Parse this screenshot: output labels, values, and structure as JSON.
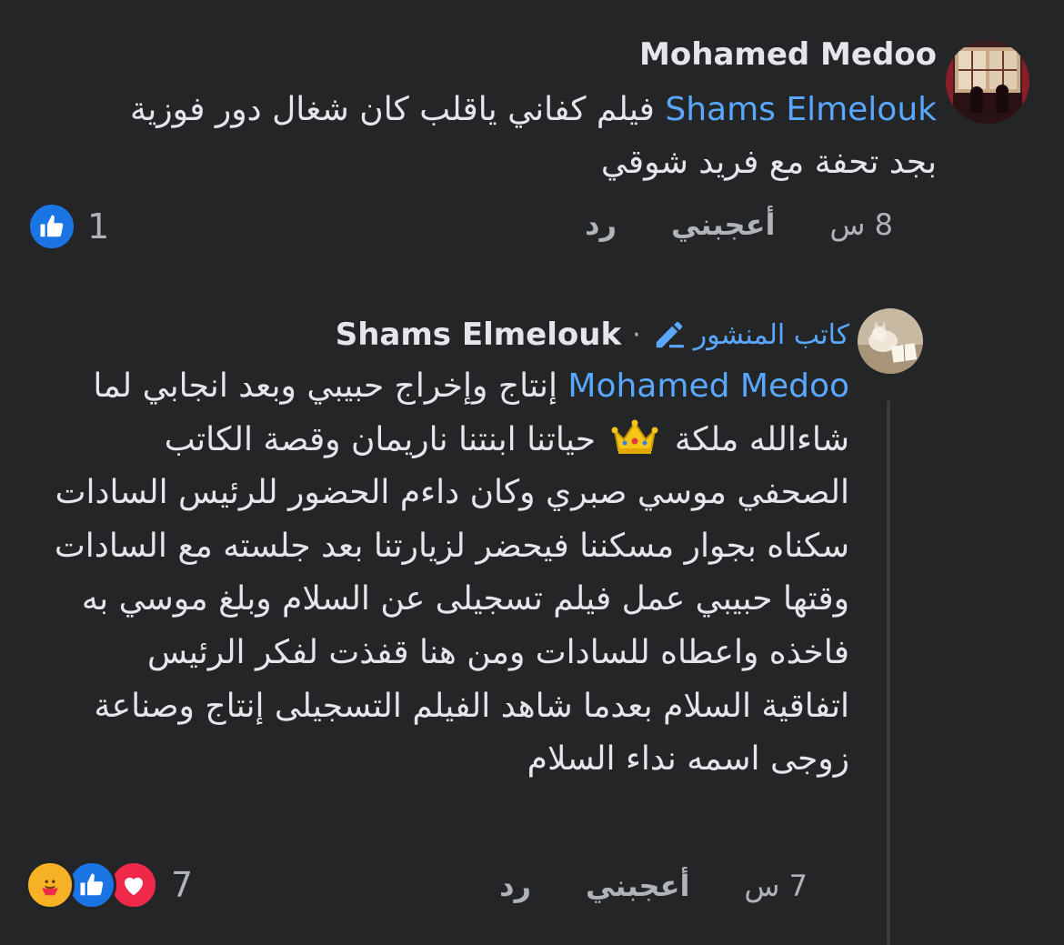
{
  "comment1": {
    "author": "Mohamed Medoo",
    "mention": "Shams Elmelouk",
    "text": "فيلم كفاني ياقلب كان شغال دور فوزية بجد تحفة مع فريد شوقي",
    "time": "8 س",
    "like_label": "أعجبني",
    "reply_label": "رد",
    "reaction_count": "1",
    "reaction_icons": [
      "like-icon"
    ]
  },
  "comment2": {
    "author": "Shams Elmelouk",
    "author_badge": "كاتب المنشور",
    "mention": "Mohamed Medoo",
    "text_before_emoji": "إنتاج وإخراج حبيبي  وبعد انجابي لما شاءالله ملكة",
    "emoji": "crown",
    "text_after_emoji": "حياتنا ابنتنا ناريمان وقصة الكاتب الصحفي موسي صبري وكان داءم الحضور للرئيس السادات سكناه بجوار مسكننا فيحضر لزيارتنا بعد جلسته مع السادات وقتها حبيبي عمل فيلم تسجيلى عن السلام وبلغ موسي به فاخذه واعطاه للسادات ومن هنا قفذت  لفكر الرئيس اتفاقية السلام بعدما شاهد الفيلم التسجيلى إنتاج وصناعة زوجى اسمه نداء السلام",
    "time": "7 س",
    "like_label": "أعجبني",
    "reply_label": "رد",
    "reaction_count": "7",
    "reaction_icons": [
      "care-icon",
      "like-icon",
      "love-icon"
    ]
  },
  "colors": {
    "background": "#242526",
    "text": "#e4e6eb",
    "secondary": "#b0b3b8",
    "mention": "#5aa7ff",
    "like": "#1b74e4",
    "love": "#f02849",
    "care": "#f7b125"
  }
}
